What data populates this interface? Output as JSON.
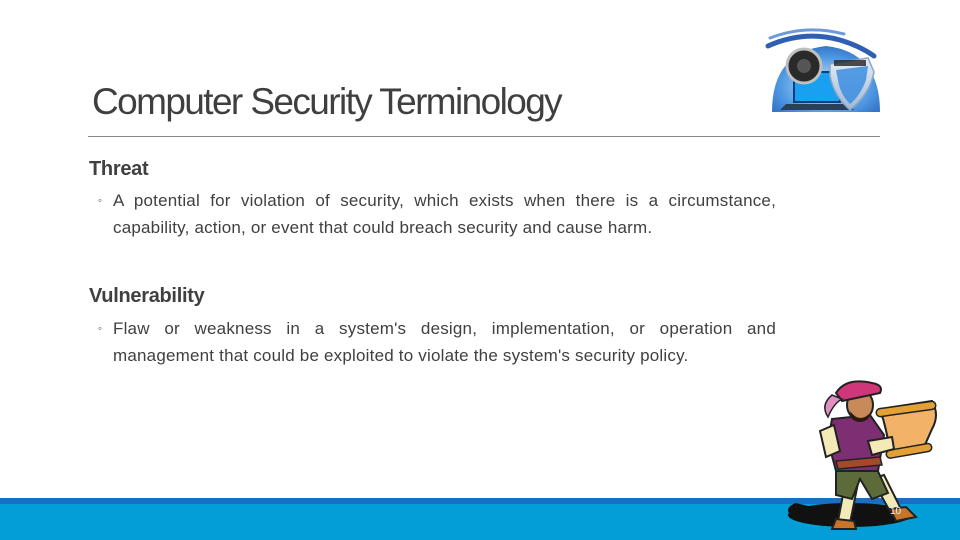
{
  "slide": {
    "title": "Computer Security Terminology",
    "page_number": "10",
    "sections": [
      {
        "heading": "Threat",
        "bullet": "A potential for violation of security, which exists when there is a circumstance, capability, action, or event that could breach security and cause harm."
      },
      {
        "heading": "Vulnerability",
        "bullet": "Flaw or weakness in a system's design, implementation, or operation and management that could be exploited to violate the system's security policy."
      }
    ],
    "bullet_symbol": "◦",
    "images": {
      "top_right": "security-laptop-shield-icon",
      "bottom_right": "herald-reading-scroll-clipart"
    },
    "colors": {
      "title": "#3f3f3f",
      "body_text": "#404040",
      "footer_band": "#039ed8",
      "footer_stripe": "#1a6fc0"
    }
  }
}
